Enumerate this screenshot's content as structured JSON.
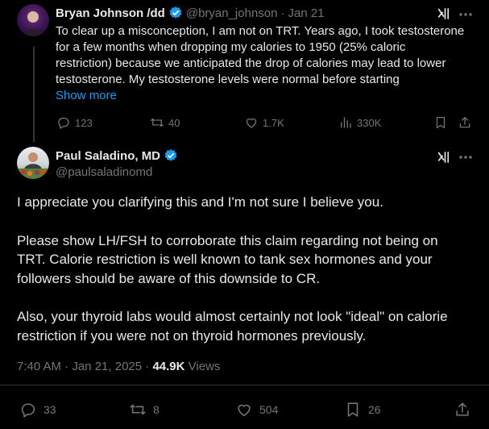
{
  "reply_tweet": {
    "author_name": "Bryan Johnson /dd",
    "handle": "@bryan_johnson",
    "separator": "·",
    "date": "Jan 21",
    "lines": [
      "To clear up a misconception, I am not on TRT. Years ago, I took testosterone",
      "for a few months when dropping my calories to 1950 (25% caloric",
      "restriction) because we anticipated the drop of calories may lead to lower",
      "testosterone. My testosterone levels were normal before starting"
    ],
    "show_more": "Show more",
    "stats": {
      "replies": "123",
      "reposts": "40",
      "likes": "1.7K",
      "views": "330K"
    }
  },
  "main_tweet": {
    "author_name": "Paul Saladino, MD",
    "handle": "@paulsaladinomd",
    "paragraphs": [
      [
        "I appreciate you clarifying this and I'm not sure I believe you."
      ],
      [
        "Please show LH/FSH to corroborate this claim regarding not being on",
        "TRT. Calorie restriction is well known to tank sex hormones and your",
        "followers should be aware of this downside to CR."
      ],
      [
        "Also, your thyroid labs would almost certainly not look \"ideal\" on calorie",
        "restriction if you were not on thyroid hormones previously."
      ]
    ],
    "timestamp": "7:40 AM · Jan 21, 2025 ·",
    "views_count": "44.9K",
    "views_label": "Views",
    "stats": {
      "replies": "33",
      "reposts": "8",
      "likes": "504",
      "bookmarks": "26"
    }
  },
  "colors": {
    "background": "#000000",
    "text": "#e7e9ea",
    "muted": "#71767b",
    "accent": "#1d9bf0"
  },
  "icons": [
    "grok-icon",
    "more-icon",
    "reply-icon",
    "repost-icon",
    "like-icon",
    "views-icon",
    "bookmark-icon",
    "share-icon",
    "verified-badge-icon"
  ]
}
